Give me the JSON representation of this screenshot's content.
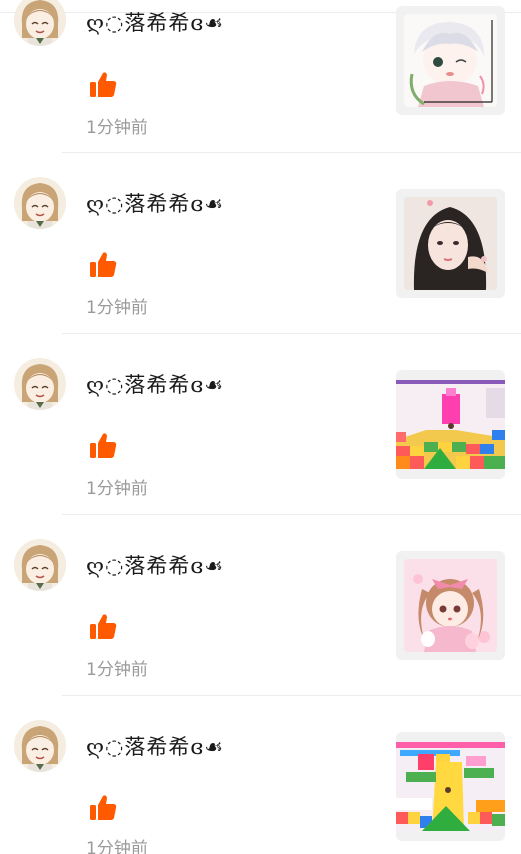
{
  "colors": {
    "like": "#ff5a00",
    "time": "#9a9a9a",
    "name": "#1a1a1a",
    "divider": "#ececec"
  },
  "notifications": [
    {
      "user_name": "ღ◌落希希ɞ☙",
      "time": "1分钟前",
      "icon": "thumbs-up-icon",
      "thumbnail": "anime-boy-sketch"
    },
    {
      "user_name": "ღ◌落希希ɞ☙",
      "time": "1分钟前",
      "icon": "thumbs-up-icon",
      "thumbnail": "girl-selfie"
    },
    {
      "user_name": "ღ◌落希希ɞ☙",
      "time": "1分钟前",
      "icon": "thumbs-up-icon",
      "thumbnail": "game-screenshot-pink-tower"
    },
    {
      "user_name": "ღ◌落希希ɞ☙",
      "time": "1分钟前",
      "icon": "thumbs-up-icon",
      "thumbnail": "anime-girl-pink-bow"
    },
    {
      "user_name": "ღ◌落希希ɞ☙",
      "time": "1分钟前",
      "icon": "thumbs-up-icon",
      "thumbnail": "game-screenshot-yellow-path"
    }
  ]
}
